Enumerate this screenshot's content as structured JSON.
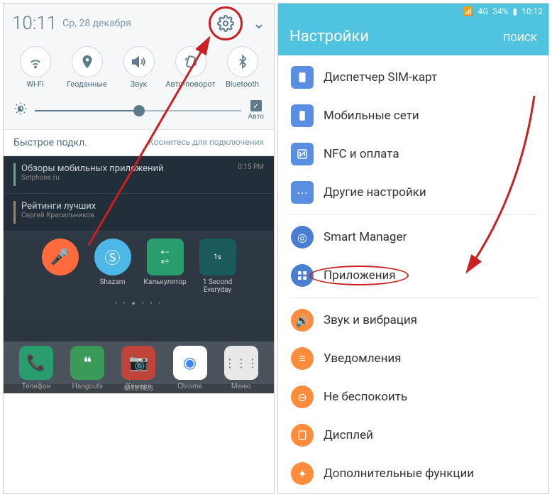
{
  "left": {
    "time": "10:11",
    "date": "Ср, 28 декабря",
    "toggles": [
      {
        "label": "Wi-Fi",
        "icon": "wifi"
      },
      {
        "label": "Геоданные",
        "icon": "location"
      },
      {
        "label": "Звук",
        "icon": "sound"
      },
      {
        "label": "Авто-поворот",
        "icon": "rotate"
      },
      {
        "label": "Bluetooth",
        "icon": "bluetooth"
      }
    ],
    "brightness_auto": "Авто",
    "quick_connect_title": "Быстрое подкл.",
    "quick_connect_hint": "Коснитесь для подключения",
    "notifications": [
      {
        "title": "Обзоры мобильных приложений",
        "sub": "Setphone.ru",
        "time": "0:15 PM"
      },
      {
        "title": "Рейтинги лучших",
        "sub": "Сергей Красильников",
        "time": ""
      }
    ],
    "apps_row": [
      {
        "label": "",
        "color": "#ff6b3d",
        "icon": "mic"
      },
      {
        "label": "Shazam",
        "color": "#4db8e8",
        "icon": "shazam"
      },
      {
        "label": "Калькулятор",
        "color": "#2a9d6e",
        "icon": "calc"
      },
      {
        "label": "1 Second Everyday",
        "color": "#1a5a5a",
        "icon": "1s"
      }
    ],
    "dock": [
      {
        "label": "Телефон",
        "color": "#2a9d6e",
        "icon": "phone"
      },
      {
        "label": "Hangouts",
        "color": "#3a9a5a",
        "icon": "hangouts"
      },
      {
        "label": "Камера",
        "color": "#c0443a",
        "icon": "camera"
      },
      {
        "label": "Chrome",
        "color": "#fff",
        "icon": "chrome"
      },
      {
        "label": "Меню",
        "color": "#e8e8e8",
        "icon": "menu"
      }
    ],
    "carrier": "MTS RUS"
  },
  "right": {
    "status": {
      "signal": "4G",
      "battery": "34%",
      "time": "10:12"
    },
    "header_title": "Настройки",
    "header_search": "ПОИСК",
    "items": [
      {
        "label": "Диспетчер SIM-карт",
        "color": "#5a8ee0",
        "icon": "sim"
      },
      {
        "label": "Мобильные сети",
        "color": "#5a8ee0",
        "icon": "mobile"
      },
      {
        "label": "NFC и оплата",
        "color": "#5a8ee0",
        "icon": "nfc"
      },
      {
        "label": "Другие настройки",
        "color": "#5a8ee0",
        "icon": "more"
      },
      {
        "label": "Smart Manager",
        "color": "#4a7ed0",
        "icon": "smart"
      },
      {
        "label": "Приложения",
        "color": "#4a7ed0",
        "icon": "apps",
        "highlight": true
      },
      {
        "label": "Звук и вибрация",
        "color": "#ff8c3a",
        "icon": "sound"
      },
      {
        "label": "Уведомления",
        "color": "#ff8c3a",
        "icon": "notif"
      },
      {
        "label": "Не беспокоить",
        "color": "#ff8c3a",
        "icon": "dnd"
      },
      {
        "label": "Дисплей",
        "color": "#ff8c3a",
        "icon": "display"
      },
      {
        "label": "Дополнительные функции",
        "color": "#ff8c3a",
        "icon": "adv"
      }
    ]
  }
}
